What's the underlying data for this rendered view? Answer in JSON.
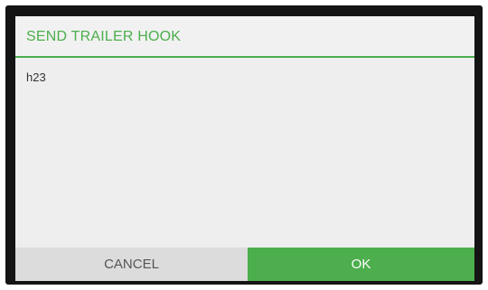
{
  "dialog": {
    "title": "SEND TRAILER HOOK",
    "message": "h23",
    "buttons": {
      "cancel_label": "CANCEL",
      "ok_label": "OK"
    }
  },
  "colors": {
    "accent": "#4cae4c",
    "frame": "#141414",
    "dialog_background": "#eeeeee",
    "cancel_background": "#dcdcdc"
  }
}
